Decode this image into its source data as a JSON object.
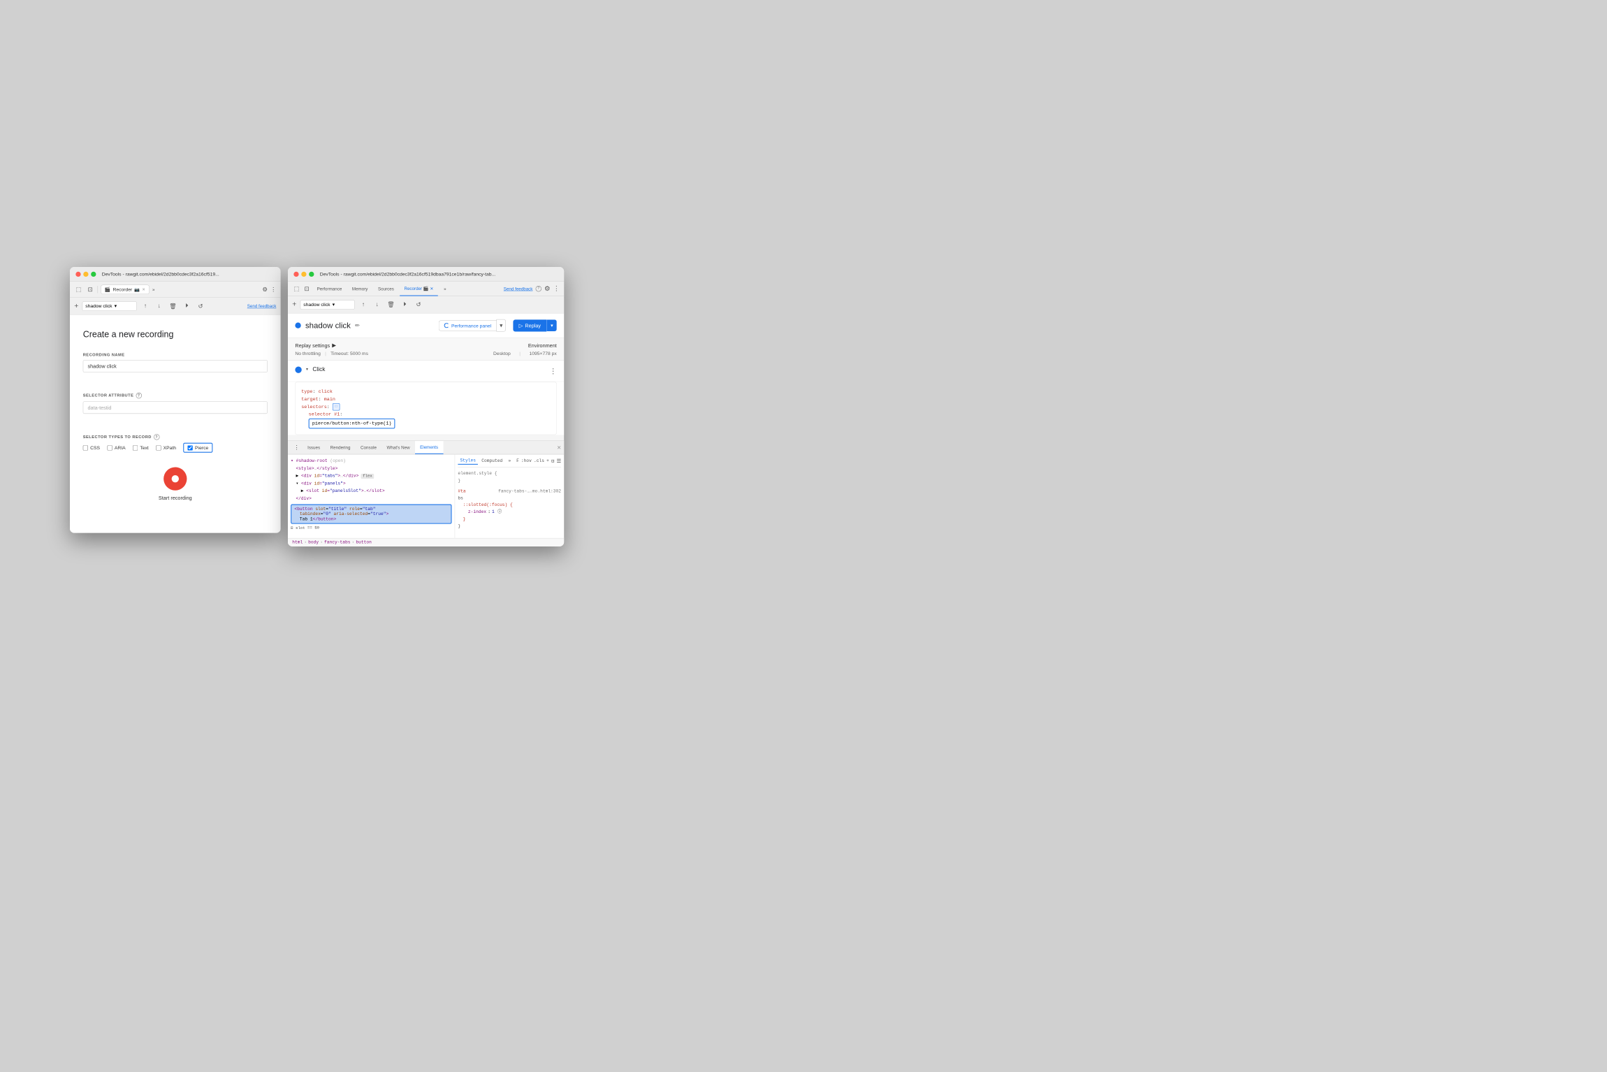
{
  "leftWindow": {
    "titlebar": {
      "title": "DevTools - rawgit.com/ebidel/2d2bb0cdec3f2a16cf519...",
      "tab_label": "Recorder",
      "tab_icon": "🎬"
    },
    "toolbar": {
      "add_label": "+",
      "dropdown_value": "shadow click",
      "send_feedback": "Send feedback"
    },
    "form": {
      "title": "Create a new recording",
      "recording_name_label": "RECORDING NAME",
      "recording_name_value": "shadow click",
      "selector_attribute_label": "SELECTOR ATTRIBUTE",
      "selector_attribute_placeholder": "data-testid",
      "selector_types_label": "SELECTOR TYPES TO RECORD",
      "checkboxes": [
        {
          "label": "CSS",
          "checked": false
        },
        {
          "label": "ARIA",
          "checked": false
        },
        {
          "label": "Text",
          "checked": false
        },
        {
          "label": "XPath",
          "checked": false
        },
        {
          "label": "Pierce",
          "checked": true
        }
      ],
      "start_button": "Start recording"
    }
  },
  "rightWindow": {
    "titlebar": {
      "title": "DevTools - rawgit.com/ebidel/2d2bb0cdec3f2a16cf519dbaa791ce1b/raw/fancy-tab...",
      "send_feedback": "Send feedback"
    },
    "devtools_tabs": [
      {
        "label": "Performance",
        "active": false
      },
      {
        "label": "Memory",
        "active": false
      },
      {
        "label": "Sources",
        "active": false
      },
      {
        "label": "Recorder",
        "active": true
      },
      {
        "label": "»",
        "active": false
      }
    ],
    "recording": {
      "name": "shadow click",
      "status": "active",
      "perf_panel_label": "Performance panel",
      "replay_label": "Replay"
    },
    "replay_settings": {
      "title": "Replay settings",
      "throttling": "No throttling",
      "timeout": "Timeout: 5000 ms",
      "environment_label": "Environment",
      "environment_value": "Desktop",
      "dimensions": "1095×778 px"
    },
    "step": {
      "type": "Click",
      "code": {
        "type_key": "type",
        "type_val": "click",
        "target_key": "target",
        "target_val": "main",
        "selectors_key": "selectors",
        "selector_num_label": "selector #1:",
        "selector_val": "pierce/button:nth-of-type(1)"
      }
    },
    "bottom_tabs": [
      {
        "label": "Issues",
        "active": false
      },
      {
        "label": "Rendering",
        "active": false
      },
      {
        "label": "Console",
        "active": false
      },
      {
        "label": "What's New",
        "active": false
      },
      {
        "label": "Elements",
        "active": true
      }
    ],
    "elements": {
      "html_lines": [
        {
          "text": "▾ #shadow-root",
          "type": "shadow-root",
          "indent": 0
        },
        {
          "text": "  <style>…</style>",
          "type": "normal",
          "indent": 1
        },
        {
          "text": "  ▶ <div id=\"tabs\">…</div>",
          "type": "normal",
          "indent": 1,
          "badge": "flex"
        },
        {
          "text": "  ▾ <div id=\"panels\">",
          "type": "normal",
          "indent": 1
        },
        {
          "text": "      ▶ <slot id=\"panelsSlot\">…</slot>",
          "type": "normal",
          "indent": 2
        },
        {
          "text": "    </div>",
          "type": "normal",
          "indent": 1
        }
      ],
      "selected_html": "<button slot=\"title\" role=\"tab\"\n  tabindex=\"0\" aria-selected=\"true\">\n  Tab 1</button>",
      "breadcrumb": [
        "html",
        "body",
        "fancy-tabs",
        "button"
      ],
      "styles_panel": {
        "tabs": [
          "Styles",
          "Computed",
          "»"
        ],
        "filter_placeholder": "F",
        "filter_options": [
          ":hov",
          ".cls",
          "+"
        ],
        "rules": [
          {
            "selector": "element.style",
            "properties": []
          },
          {
            "selector": "#ta",
            "source": "fancy-tabs-….mo.html:302",
            "source_label": "bs",
            "properties": [
              {
                "prop": "::slotted(:focus)",
                "sub": true
              },
              {
                "name": "z-index",
                "val": "1"
              }
            ]
          }
        ]
      }
    }
  }
}
